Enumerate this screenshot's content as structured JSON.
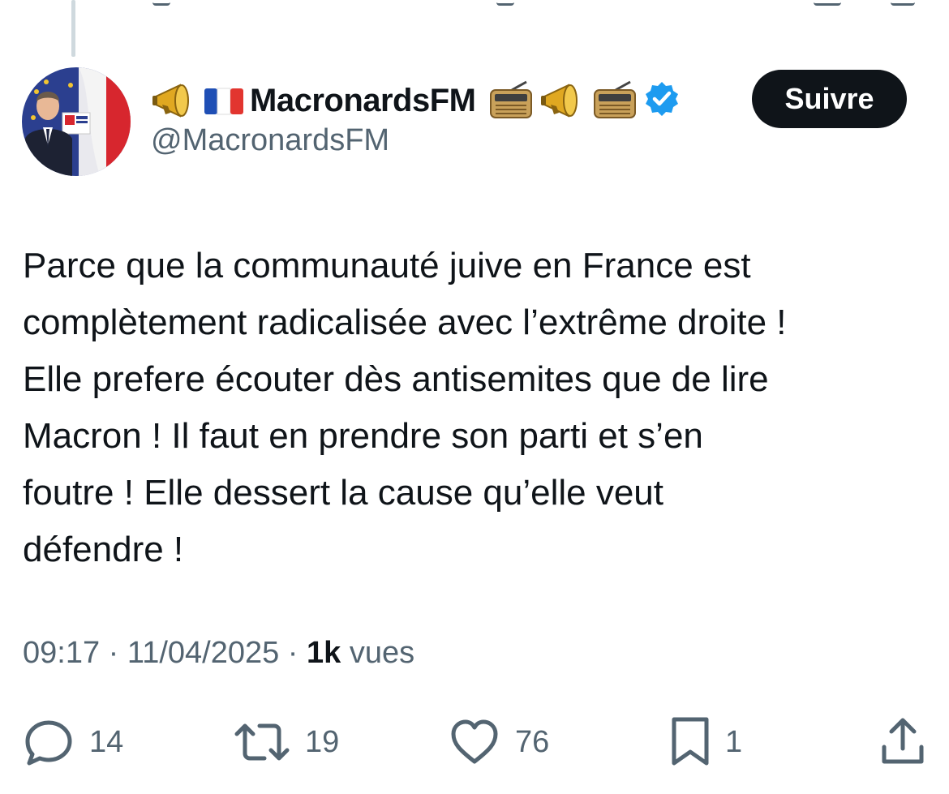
{
  "author": {
    "display_name": "MacronardsFM",
    "handle": "@MacronardsFM",
    "verified": true,
    "name_emojis_before": [
      "megaphone-icon",
      "france-flag-icon"
    ],
    "name_emojis_after": [
      "radio-icon",
      "megaphone-icon",
      "radio-icon"
    ]
  },
  "follow_button": {
    "label": "Suivre"
  },
  "tweet": {
    "lines": [
      "Parce que la communauté juive en France est",
      "complètement radicalisée avec l’extrême droite !",
      "Elle prefere écouter dès antisemites que de lire",
      "Macron ! Il faut en prendre son parti et s’en",
      "foutre ! Elle dessert la cause qu’elle veut",
      "défendre !"
    ]
  },
  "meta": {
    "time": "09:17",
    "separator": " · ",
    "date": "11/04/2025",
    "views_count": "1k",
    "views_label": "vues"
  },
  "actions": {
    "replies": "14",
    "reposts": "19",
    "likes": "76",
    "bookmarks": "1"
  },
  "colors": {
    "text": "#0f1419",
    "secondary": "#536471",
    "verified": "#1d9bf0",
    "button_bg": "#0f1419",
    "button_text": "#ffffff"
  }
}
